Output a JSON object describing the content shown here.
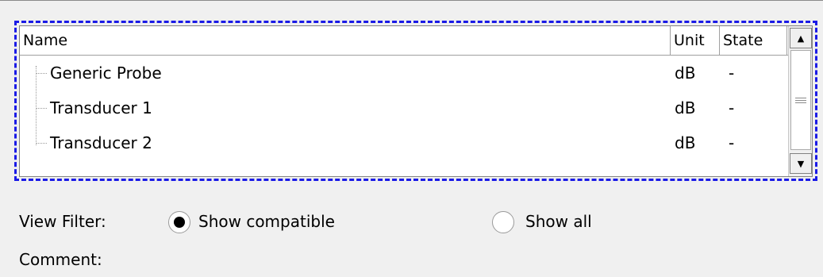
{
  "list": {
    "columns": {
      "name": "Name",
      "unit": "Unit",
      "state": "State"
    },
    "rows": [
      {
        "name": "Generic Probe",
        "unit": "dB",
        "state": "-"
      },
      {
        "name": "Transducer 1",
        "unit": "dB",
        "state": "-"
      },
      {
        "name": "Transducer 2",
        "unit": "dB",
        "state": "-"
      }
    ]
  },
  "scrollbar": {
    "up_icon": "▲",
    "down_icon": "▼"
  },
  "filter": {
    "label": "View Filter:",
    "options": [
      {
        "label": "Show compatible",
        "selected": true
      },
      {
        "label": "Show all",
        "selected": false
      }
    ]
  },
  "comment": {
    "label": "Comment:"
  },
  "colors": {
    "focus_border": "#1a1ae6",
    "background": "#f0f0f0"
  }
}
